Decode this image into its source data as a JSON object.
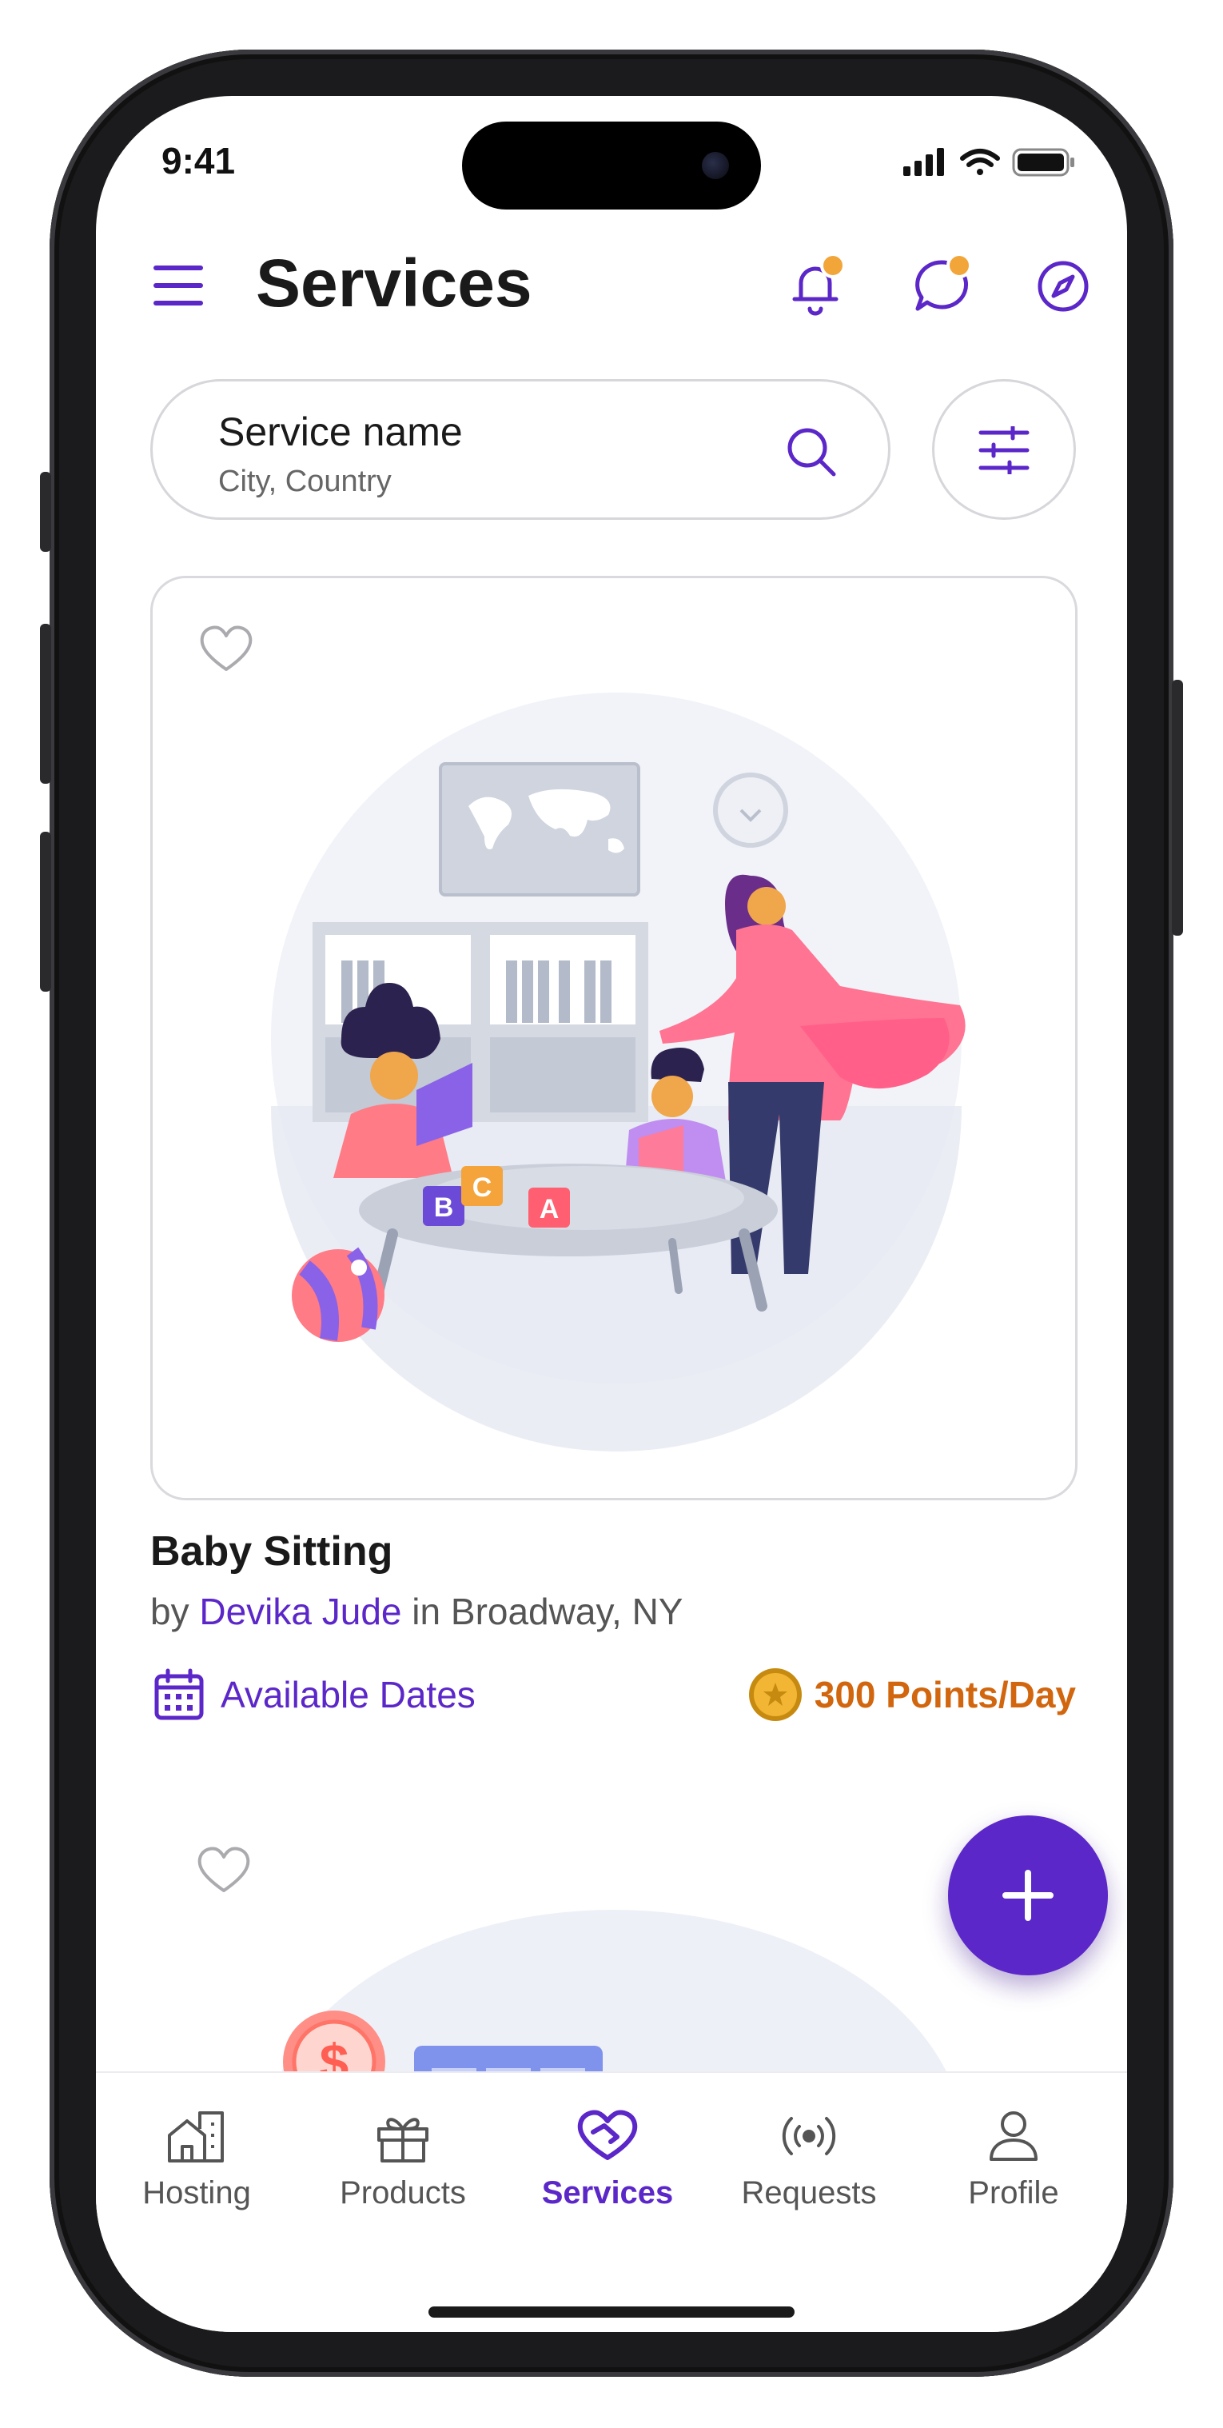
{
  "status_bar": {
    "time": "9:41"
  },
  "header": {
    "title": "Services"
  },
  "search": {
    "title": "Service name",
    "subtitle": "City, Country"
  },
  "cards": [
    {
      "title": "Baby Sitting",
      "by_prefix": "by",
      "host": "Devika Jude",
      "in_prefix": "in",
      "location": "Broadway, NY",
      "available_label": "Available Dates",
      "points_label": "300 Points/Day",
      "illustration_blocks": [
        "B",
        "C",
        "A"
      ]
    }
  ],
  "tabs": [
    {
      "label": "Hosting",
      "icon": "hosting-icon",
      "active": false
    },
    {
      "label": "Products",
      "icon": "gift-icon",
      "active": false
    },
    {
      "label": "Services",
      "icon": "heart-handshake-icon",
      "active": true
    },
    {
      "label": "Requests",
      "icon": "broadcast-icon",
      "active": false
    },
    {
      "label": "Profile",
      "icon": "user-icon",
      "active": false
    }
  ],
  "colors": {
    "accent": "#5b27c9",
    "points": "#d1660e",
    "notification_dot": "#f2a63a"
  }
}
